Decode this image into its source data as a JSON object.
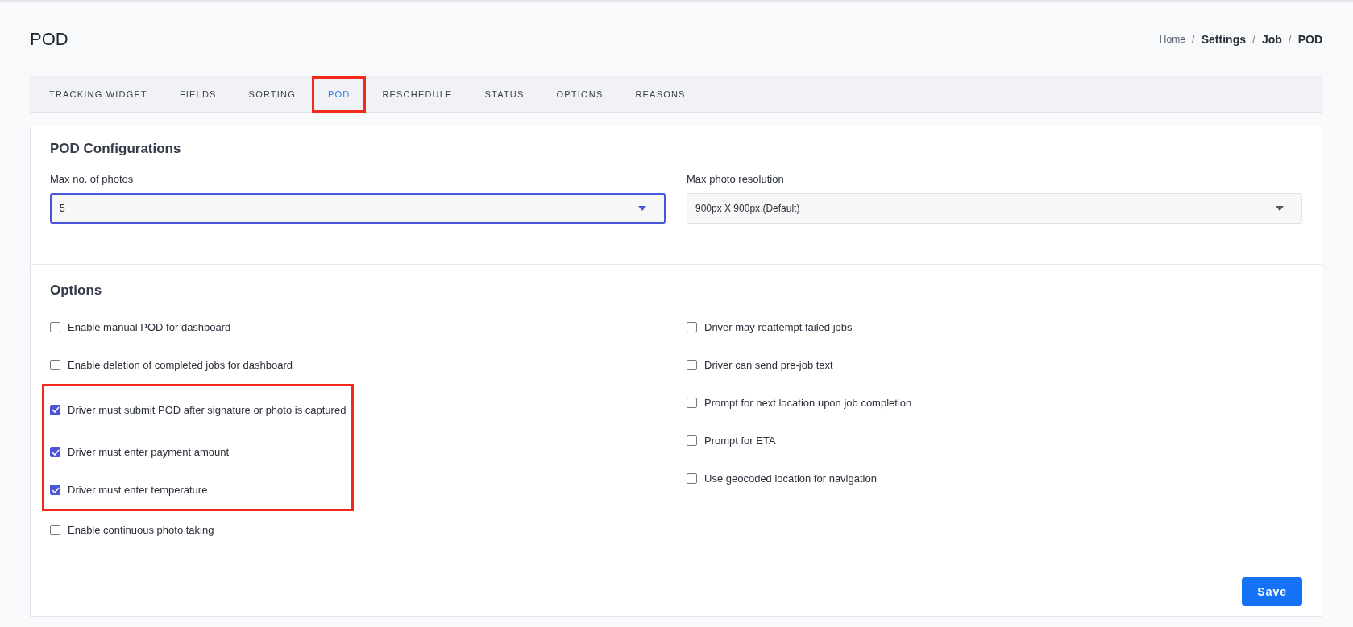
{
  "page_title": "POD",
  "breadcrumb_separator": "/",
  "breadcrumb": [
    {
      "label": "Home",
      "current": false
    },
    {
      "label": "Settings",
      "current": true
    },
    {
      "label": "Job",
      "current": true
    },
    {
      "label": "POD",
      "current": true
    }
  ],
  "tabs": [
    {
      "label": "TRACKING WIDGET",
      "selected": false,
      "highlighted": false
    },
    {
      "label": "FIELDS",
      "selected": false,
      "highlighted": false
    },
    {
      "label": "SORTING",
      "selected": false,
      "highlighted": false
    },
    {
      "label": "POD",
      "selected": true,
      "highlighted": true
    },
    {
      "label": "RESCHEDULE",
      "selected": false,
      "highlighted": false
    },
    {
      "label": "STATUS",
      "selected": false,
      "highlighted": false
    },
    {
      "label": "OPTIONS",
      "selected": false,
      "highlighted": false
    },
    {
      "label": "REASONS",
      "selected": false,
      "highlighted": false
    }
  ],
  "configurations": {
    "title": "POD Configurations",
    "fields": [
      {
        "label": "Max no. of photos",
        "value": "5",
        "focused": true
      },
      {
        "label": "Max photo resolution",
        "value": "900px X 900px (Default)",
        "focused": false
      }
    ]
  },
  "options": {
    "title": "Options",
    "left": [
      {
        "items": [
          {
            "label": "Enable manual POD for dashboard",
            "checked": false
          },
          {
            "label": "Enable deletion of completed jobs for dashboard",
            "checked": false
          }
        ]
      },
      {
        "highlighted": true,
        "items": [
          {
            "label": "Driver must submit POD after signature or photo is captured",
            "checked": true
          },
          {
            "label": "Driver must enter payment amount",
            "checked": true
          },
          {
            "label": "Driver must enter temperature",
            "checked": true
          }
        ]
      },
      {
        "items": [
          {
            "label": "Enable continuous photo taking",
            "checked": false
          }
        ]
      }
    ],
    "right": [
      {
        "items": [
          {
            "label": "Driver may reattempt failed jobs",
            "checked": false
          },
          {
            "label": "Driver can send pre-job text",
            "checked": false
          },
          {
            "label": "Prompt for next location upon job completion",
            "checked": false
          },
          {
            "label": "Prompt for ETA",
            "checked": false
          },
          {
            "label": "Use geocoded location for navigation",
            "checked": false
          }
        ]
      }
    ]
  },
  "save_button": "Save"
}
